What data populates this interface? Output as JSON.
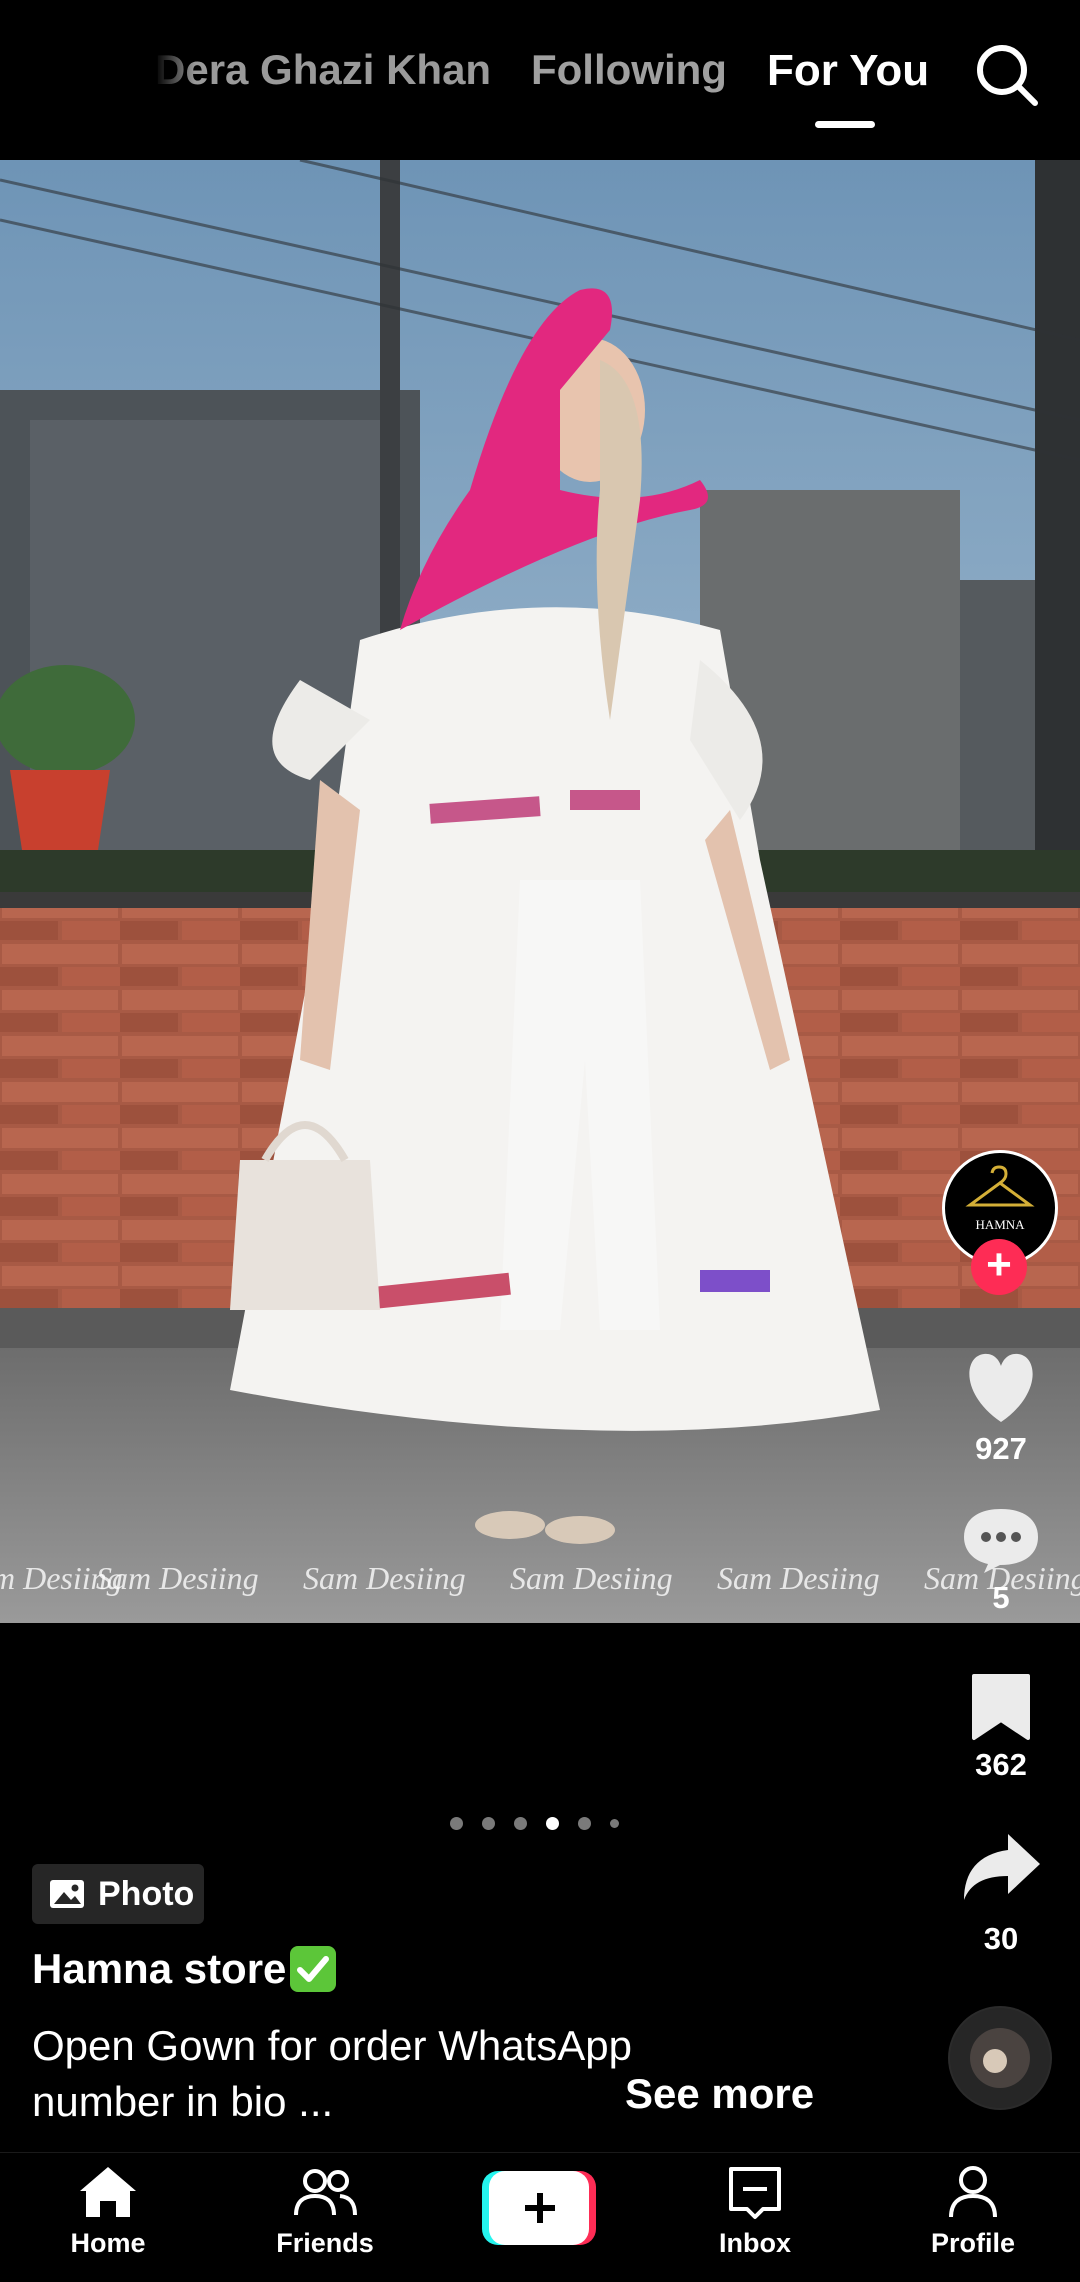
{
  "header": {
    "tabs": [
      {
        "label": "Dera Ghazi Khan",
        "active": false
      },
      {
        "label": "Following",
        "active": false
      },
      {
        "label": "For You",
        "active": true
      }
    ],
    "search_icon": "search-icon"
  },
  "post": {
    "watermark": "Sam Desiing",
    "carousel": {
      "count": 6,
      "active_index": 3
    },
    "type_label": "Photo",
    "username": "Hamna store",
    "verified_icon": "green-check-icon",
    "caption": "Open Gown for order WhatsApp number in bio ...",
    "see_more": "See more"
  },
  "rail": {
    "avatar_text": "HAMNA",
    "likes": "927",
    "comments": "5",
    "saves": "362",
    "shares": "30"
  },
  "nav": {
    "home": "Home",
    "friends": "Friends",
    "inbox": "Inbox",
    "profile": "Profile"
  },
  "colors": {
    "accent_red": "#fe2c55",
    "accent_cyan": "#25f4ee",
    "background": "#000000"
  }
}
